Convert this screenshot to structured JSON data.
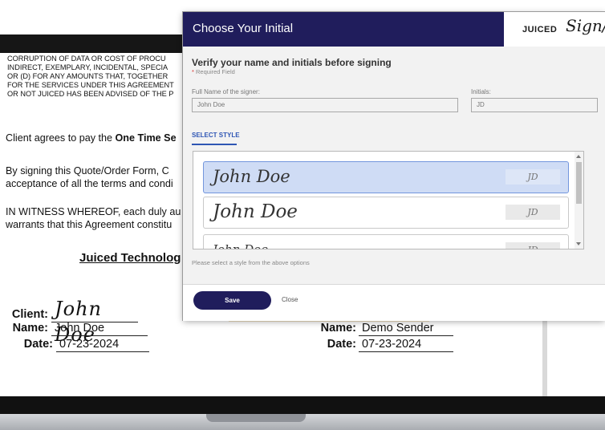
{
  "document": {
    "legal_lines": [
      "CORRUPTION OF DATA OR COST OF PROCU",
      "INDIRECT, EXEMPLARY, INCIDENTAL, SPECIA",
      "OR (D) FOR ANY AMOUNTS THAT, TOGETHER",
      "FOR THE SERVICES UNDER THIS AGREEMENT",
      "OR NOT JUICED HAS BEEN ADVISED OF THE P"
    ],
    "para1_prefix": "Client agrees to pay the ",
    "para1_bold": "One Time Se",
    "para2_line1": "By signing this Quote/Order Form, C",
    "para2_line2": "acceptance of all the terms and condi",
    "para3_line1": "IN WITNESS WHEREOF, each duly au",
    "para3_line2": "warrants that this Agreement constitu",
    "company": "Juiced Technolog",
    "client": {
      "client_label": "Client:",
      "signature": "John Doe",
      "name_label": "Name:",
      "name": "John Doe",
      "date_label": "Date:",
      "date": "07-23-2024"
    },
    "sender": {
      "name_label": "Name:",
      "name": "Demo Sender",
      "date_label": "Date:",
      "date": "07-23-2024"
    }
  },
  "modal": {
    "title": "Choose Your Initial",
    "brand_juiced": "JUICED",
    "brand_sign": "Sign/",
    "verify_title": "Verify your name and initials before signing",
    "required_star": "*",
    "required_text": "Required Field",
    "full_name_label": "Full Name of the signer:",
    "full_name_placeholder": "John Doe",
    "initials_label": "Initials:",
    "initials_placeholder": "JD",
    "select_style_label": "SELECT STYLE",
    "styles": [
      {
        "name": "John Doe",
        "initials": "JD",
        "selected": true
      },
      {
        "name": "John Doe",
        "initials": "JD",
        "selected": false
      },
      {
        "name": "John Doe",
        "initials": "JD",
        "selected": false
      }
    ],
    "hint": "Please select a style from the above options",
    "save_label": "Save",
    "close_label": "Close"
  },
  "colors": {
    "modal_header": "#201d5c",
    "accent": "#2f56b4",
    "selected_bg": "#cfdcf5",
    "required_star": "#d9302c"
  }
}
